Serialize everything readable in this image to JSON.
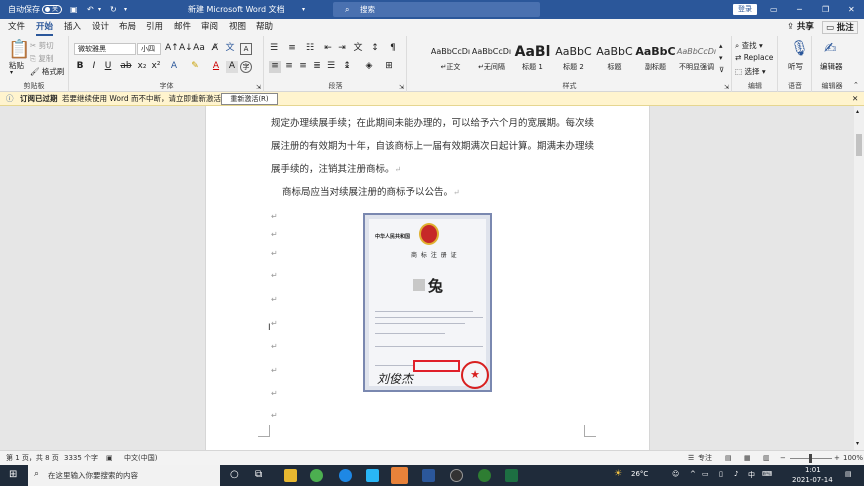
{
  "titlebar": {
    "autosave_label": "自动保存",
    "autosave_state": "关",
    "doc_title": "新建 Microsoft Word 文档",
    "search_placeholder": "搜索",
    "login_label": "登录"
  },
  "tabs": [
    "文件",
    "开始",
    "插入",
    "设计",
    "布局",
    "引用",
    "邮件",
    "审阅",
    "视图",
    "帮助"
  ],
  "share_label": "共享",
  "comment_label": "批注",
  "ribbon": {
    "clipboard": {
      "paste": "粘贴",
      "cut": "剪切",
      "copy": "复制",
      "format_painter": "格式刷",
      "label": "剪贴板"
    },
    "font": {
      "name": "微软雅黑",
      "size": "小四",
      "label": "字体"
    },
    "paragraph": {
      "label": "段落"
    },
    "styles": {
      "label": "样式",
      "items": [
        {
          "preview": "AaBbCcDı",
          "name": "↵正文"
        },
        {
          "preview": "AaBbCcDı",
          "name": "↵无间隔"
        },
        {
          "preview": "AaBl",
          "name": "标题 1"
        },
        {
          "preview": "AaBbC",
          "name": "标题 2"
        },
        {
          "preview": "AaBbC",
          "name": "标题"
        },
        {
          "preview": "AaBbC",
          "name": "副标题"
        },
        {
          "preview": "AaBbCcDı",
          "name": "不明显强调"
        }
      ]
    },
    "editing": {
      "find": "查找",
      "replace": "Replace",
      "select": "选择",
      "label": "编辑"
    },
    "voice": {
      "dictate": "听写",
      "label": "语音"
    },
    "editor": {
      "name": "编辑器",
      "label": "编辑器"
    }
  },
  "infobar": {
    "title": "订阅已过期",
    "message": "若要继续使用 Word 而不中断，请立即重新激活。",
    "button": "重新激活(R)"
  },
  "document": {
    "lines": [
      "规定办理续展手续；在此期间未能办理的，可以给予六个月的宽展期。每次续",
      "展注册的有效期为十年，自该商标上一届有效期满次日起计算。期满未办理续",
      "展手续的，注销其注册商标。",
      "商标局应当对续展注册的商标予以公告。"
    ],
    "cert": {
      "header": "中华人民共和国",
      "title": "商 标 注 册 证",
      "trademark": "兔",
      "signature": "刘俊杰"
    }
  },
  "statusbar": {
    "page": "第 1 页，共 8 页",
    "words": "3335 个字",
    "language": "中文(中国)",
    "focus": "专注",
    "zoom": "100%"
  },
  "taskbar": {
    "search_placeholder": "在这里输入你要搜索的内容",
    "weather": "26°C",
    "time": "1:01",
    "date": "2021-07-14",
    "ime": "中"
  }
}
